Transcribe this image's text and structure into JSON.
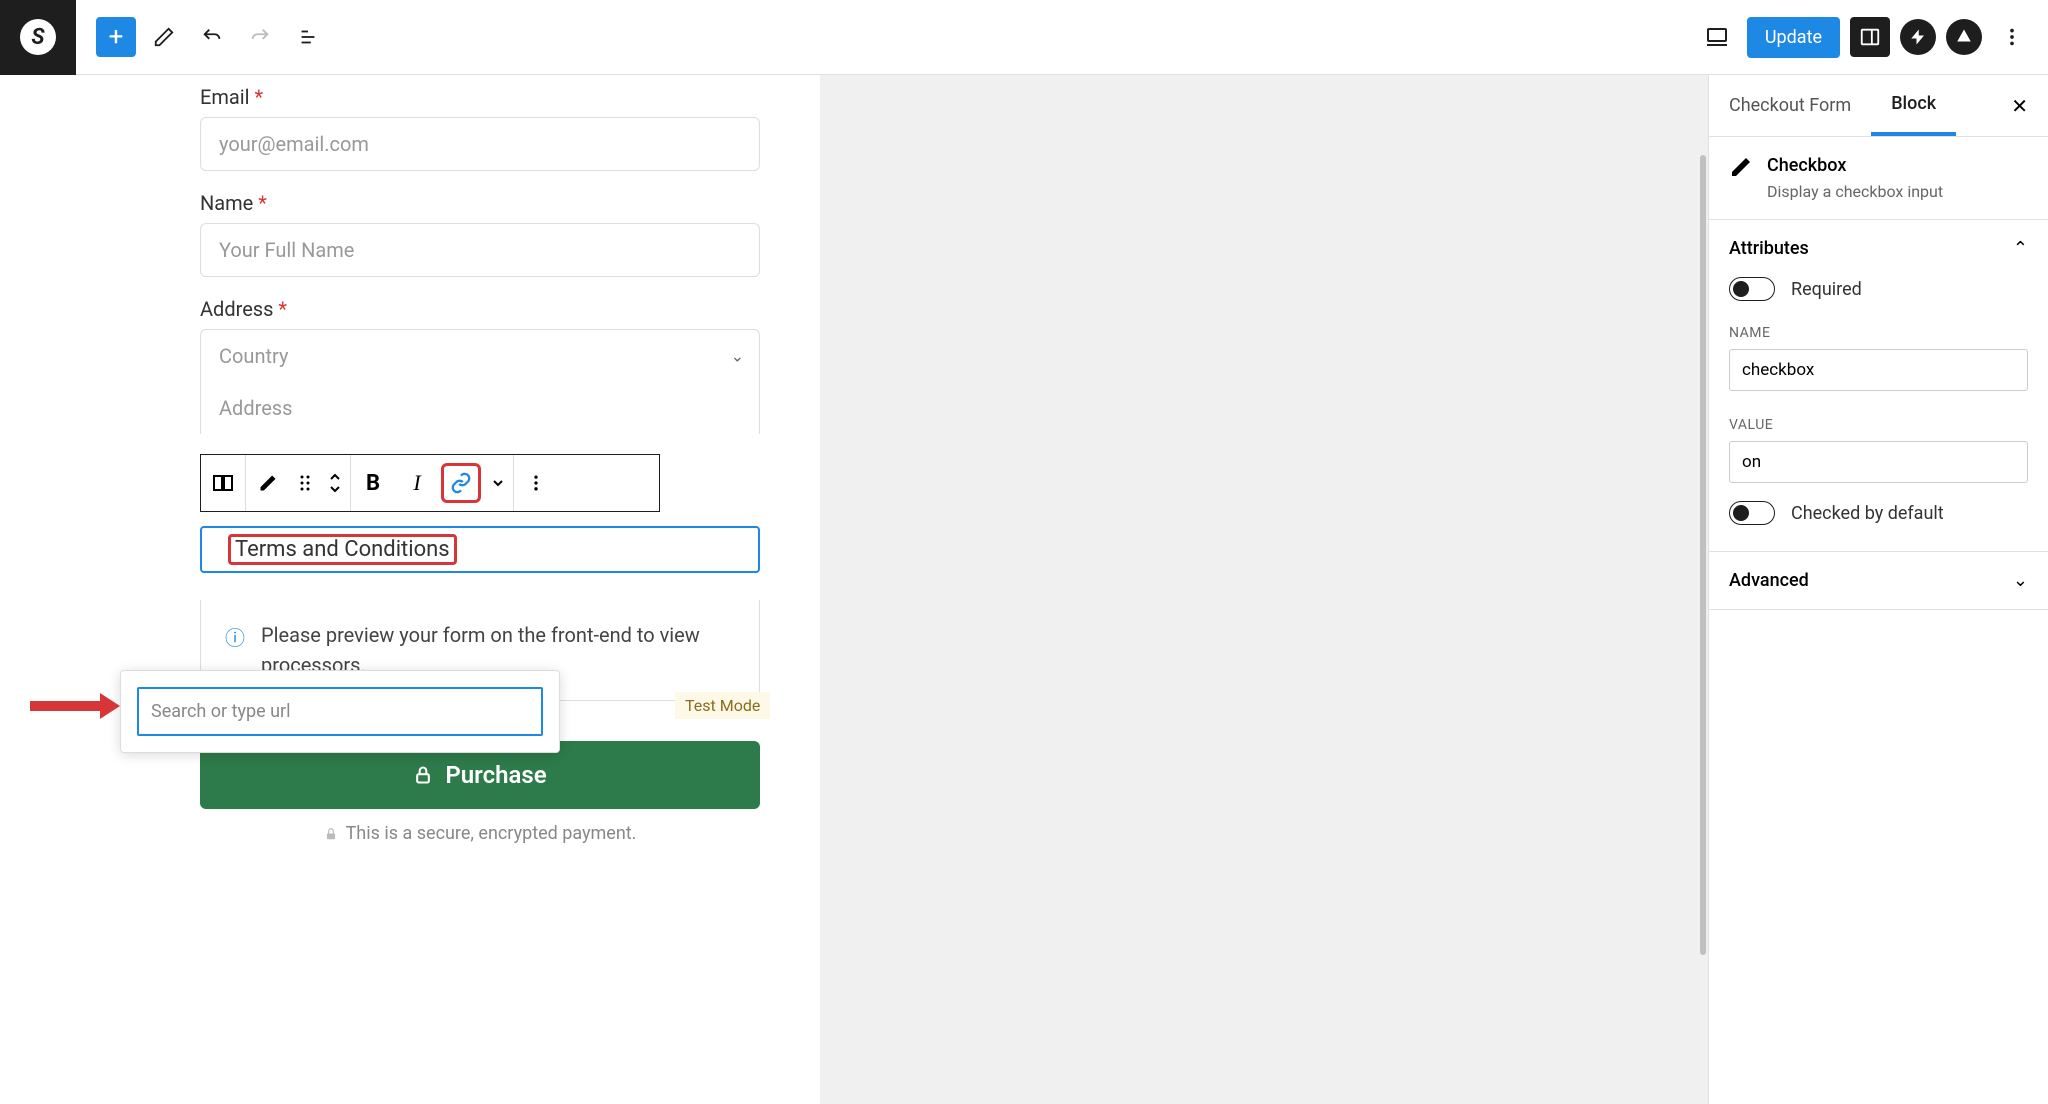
{
  "topbar": {
    "update_label": "Update"
  },
  "form": {
    "email_label": "Email",
    "email_placeholder": "your@email.com",
    "name_label": "Name",
    "name_placeholder": "Your Full Name",
    "address_label": "Address",
    "country_placeholder": "Country",
    "address_placeholder": "Address",
    "terms_text": "Terms and Conditions",
    "test_mode": "Test Mode",
    "info_text": "Please preview your form on the front-end to view processors.",
    "purchase_label": "Purchase",
    "secure_text": "This is a secure, encrypted payment.",
    "url_placeholder": "Search or type url"
  },
  "sidebar": {
    "tab_form": "Checkout Form",
    "tab_block": "Block",
    "block_title": "Checkbox",
    "block_desc": "Display a checkbox input",
    "attributes_title": "Attributes",
    "required_label": "Required",
    "name_label": "NAME",
    "name_value": "checkbox",
    "value_label": "VALUE",
    "value_value": "on",
    "checked_label": "Checked by default",
    "advanced_title": "Advanced"
  }
}
